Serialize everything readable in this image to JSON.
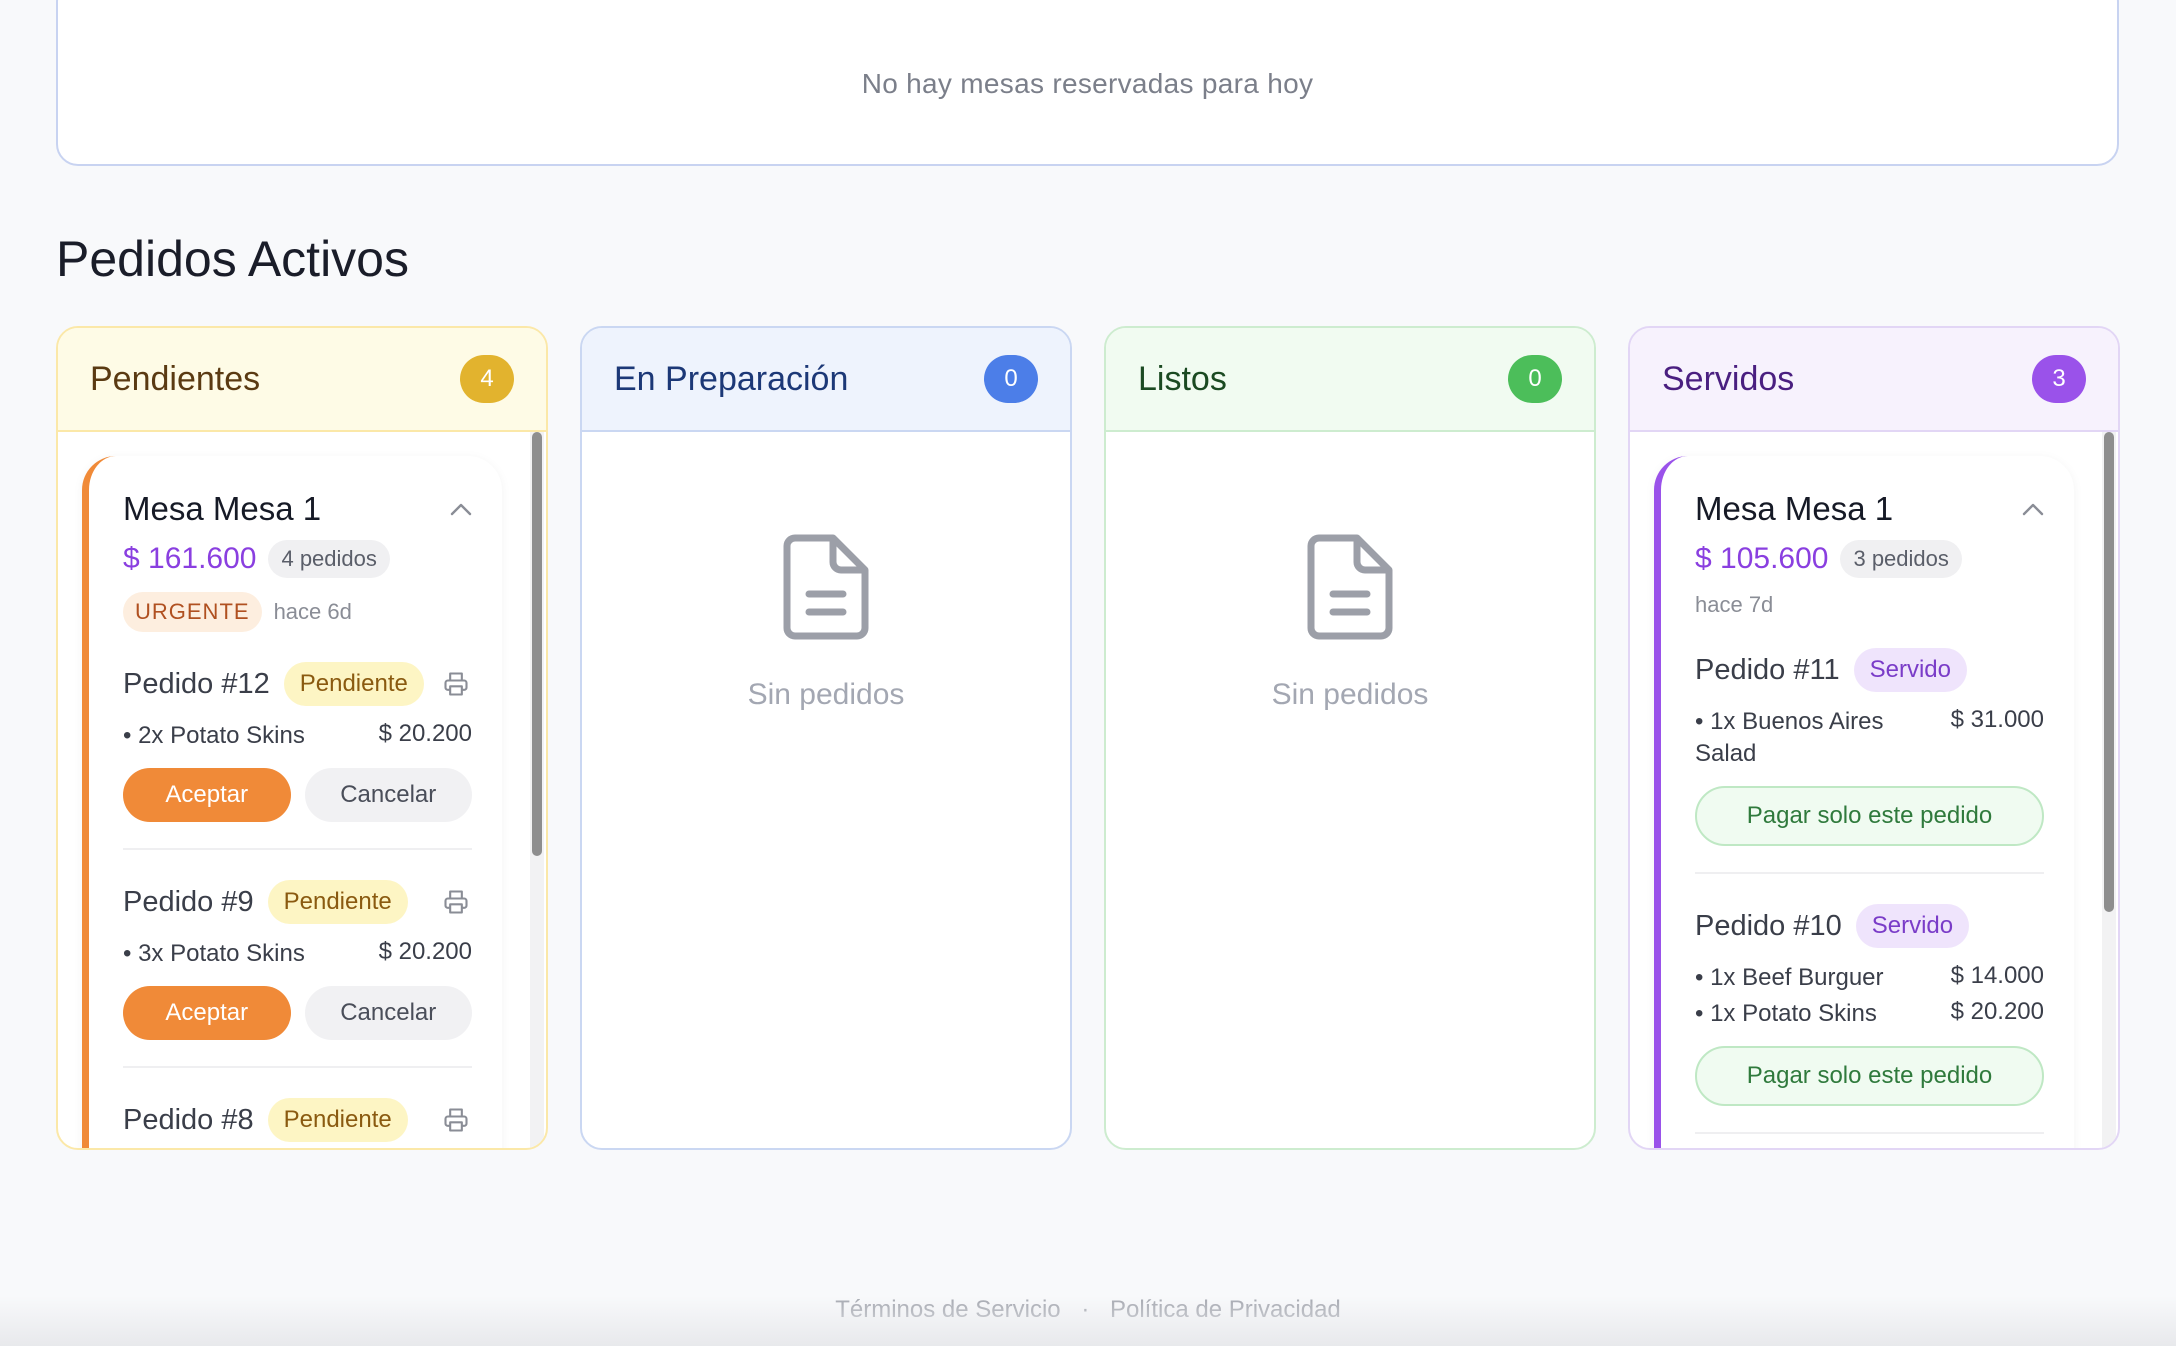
{
  "reservas": {
    "empty_text": "No hay mesas reservadas para hoy"
  },
  "section_title": "Pedidos Activos",
  "columns": [
    {
      "title": "Pendientes",
      "count": "4",
      "color": "#e2b32e"
    },
    {
      "title": "En Preparación",
      "count": "0",
      "color": "#4c7ee8",
      "empty_text": "Sin pedidos"
    },
    {
      "title": "Listos",
      "count": "0",
      "color": "#4cbe5a",
      "empty_text": "Sin pedidos"
    },
    {
      "title": "Servidos",
      "count": "3",
      "color": "#9a52ea"
    }
  ],
  "pendientes_card": {
    "mesa": "Mesa Mesa 1",
    "total": "$ 161.600",
    "pedidos_count": "4 pedidos",
    "urgent_label": "URGENTE",
    "ago": "hace 6d",
    "pedidos": [
      {
        "title": "Pedido #12",
        "status": "Pendiente",
        "items": [
          {
            "name": "• 2x Potato Skins",
            "price": "$ 20.200"
          }
        ],
        "accept": "Aceptar",
        "cancel": "Cancelar"
      },
      {
        "title": "Pedido #9",
        "status": "Pendiente",
        "items": [
          {
            "name": "• 3x Potato Skins",
            "price": "$ 20.200"
          }
        ],
        "accept": "Aceptar",
        "cancel": "Cancelar"
      },
      {
        "title": "Pedido #8",
        "status": "Pendiente"
      }
    ]
  },
  "servidos_card": {
    "mesa": "Mesa Mesa 1",
    "total": "$ 105.600",
    "pedidos_count": "3 pedidos",
    "ago": "hace 7d",
    "pedidos": [
      {
        "title": "Pedido #11",
        "status": "Servido",
        "items": [
          {
            "name": "• 1x Buenos Aires Salad",
            "price": "$ 31.000"
          }
        ],
        "pay": "Pagar solo este pedido"
      },
      {
        "title": "Pedido #10",
        "status": "Servido",
        "items": [
          {
            "name": "• 1x Beef Burguer",
            "price": "$ 14.000"
          },
          {
            "name": "• 1x Potato Skins",
            "price": "$ 20.200"
          }
        ],
        "pay": "Pagar solo este pedido"
      }
    ]
  },
  "footer": {
    "terms": "Términos de Servicio",
    "separator": "·",
    "privacy": "Política de Privacidad"
  }
}
